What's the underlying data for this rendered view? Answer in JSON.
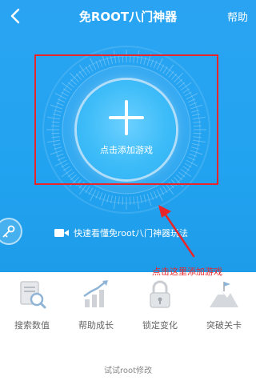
{
  "header": {
    "back_icon": "chevron-left-icon",
    "title": "免ROOT八门神器",
    "help_label": "帮助"
  },
  "main": {
    "add_button_icon": "plus-icon",
    "add_label": "点击添加游戏",
    "video_icon": "video-camera-icon",
    "video_link_text": "快速看懂免root八门神器玩法",
    "key_icon": "key-icon"
  },
  "annotation": {
    "text": "点击这里添加游戏",
    "color": "#e8262a"
  },
  "features": [
    {
      "label": "搜索数值",
      "icon": "search-document-icon"
    },
    {
      "label": "帮助成长",
      "icon": "growth-chart-icon"
    },
    {
      "label": "锁定变化",
      "icon": "lock-icon"
    },
    {
      "label": "突破关卡",
      "icon": "mountain-flag-icon"
    }
  ],
  "footer": {
    "text": "试试root修改"
  },
  "colors": {
    "accent": "#22a3f0",
    "highlight": "#e8262a"
  }
}
